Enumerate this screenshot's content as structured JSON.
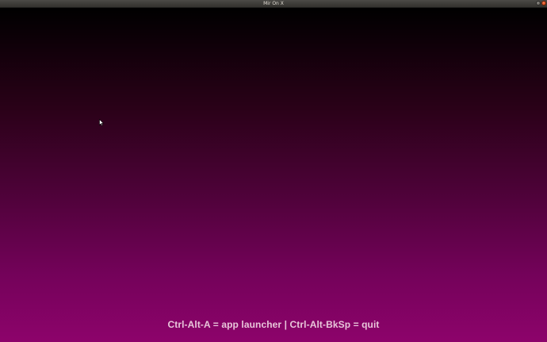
{
  "window": {
    "title": "Mir On X"
  },
  "desktop": {
    "hint": "Ctrl-Alt-A = app launcher | Ctrl-Alt-BkSp = quit"
  },
  "icons": {
    "minimize": "minimize-icon",
    "close": "close-icon",
    "cursor": "mouse-pointer-icon"
  },
  "colors": {
    "background_top": "#000000",
    "background_bottom": "#8d036b",
    "close_button": "#e95420",
    "hint_text": "#e8c6da"
  }
}
